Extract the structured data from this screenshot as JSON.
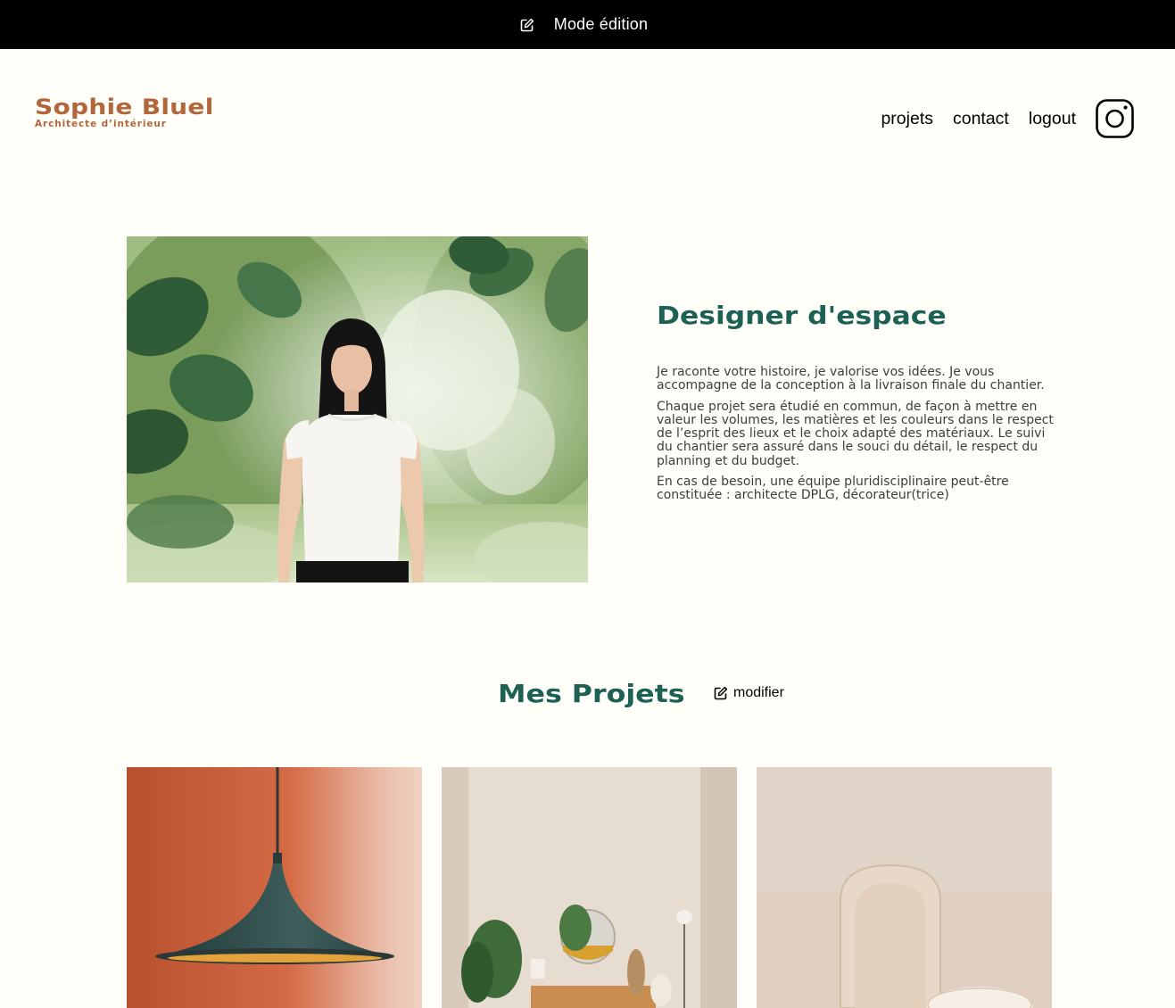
{
  "edit_bar": {
    "icon": "edit-icon",
    "label": "Mode édition"
  },
  "brand": {
    "name": "Sophie Bluel",
    "tagline": "Architecte d’intérieur"
  },
  "nav": {
    "items": [
      {
        "label": "projets"
      },
      {
        "label": "contact"
      },
      {
        "label": "logout"
      }
    ],
    "social_icon": "instagram-icon"
  },
  "intro": {
    "title": "Designer d'espace",
    "paragraphs": [
      "Je raconte votre histoire, je valorise vos idées. Je vous accompagne de la conception à la livraison finale du chantier.",
      "Chaque projet sera étudié en commun, de façon à mettre en valeur les volumes, les matières et les couleurs dans le respect de l’esprit des lieux et le choix adapté des matériaux. Le suivi du chantier sera assuré dans le souci du détail, le respect du planning et du budget.",
      "En cas de besoin, une équipe pluridisciplinaire peut-être constituée : architecte DPLG, décorateur(trice)"
    ]
  },
  "projects": {
    "title": "Mes Projets",
    "modify_label": "modifier",
    "modify_icon": "edit-icon"
  },
  "colors": {
    "background": "#FFFEF8",
    "accent": "#1D6154",
    "brand": "#B1663C",
    "edit_bar": "#000000",
    "text": "#3D3D3D"
  }
}
